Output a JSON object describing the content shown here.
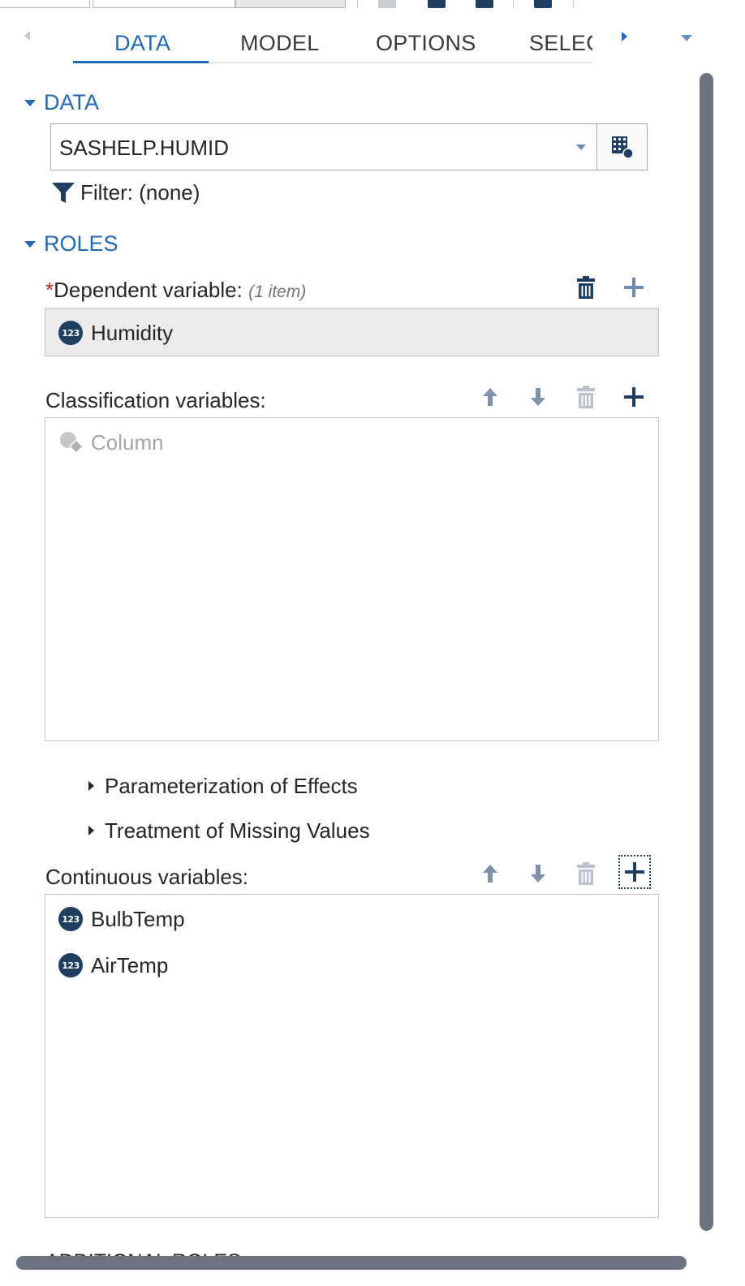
{
  "tabs": [
    {
      "label": "DATA",
      "active": true
    },
    {
      "label": "MODEL",
      "active": false
    },
    {
      "label": "OPTIONS",
      "active": false
    },
    {
      "label": "SELEC",
      "active": false
    }
  ],
  "data_section": {
    "title": "DATA",
    "dataset_value": "SASHELP.HUMID",
    "filter_label": "Filter:",
    "filter_value": "(none)"
  },
  "roles_section": {
    "title": "ROLES",
    "dependent": {
      "required_mark": "*",
      "label": "Dependent variable:",
      "count": "(1 item)",
      "items": [
        {
          "name": "Humidity",
          "type_icon": "123"
        }
      ]
    },
    "classification": {
      "label": "Classification variables:",
      "placeholder": "Column"
    },
    "expanders": [
      {
        "label": "Parameterization of Effects"
      },
      {
        "label": "Treatment of Missing Values"
      }
    ],
    "continuous": {
      "label": "Continuous variables:",
      "items": [
        {
          "name": "BulbTemp",
          "type_icon": "123"
        },
        {
          "name": "AirTemp",
          "type_icon": "123"
        }
      ]
    }
  },
  "next_section_partial": "ADDITIONAL ROLES",
  "colors": {
    "accent": "#1f69b8",
    "navy_icon": "#1f3e63",
    "required": "#d0231d",
    "scrollbar": "#6b7280"
  }
}
